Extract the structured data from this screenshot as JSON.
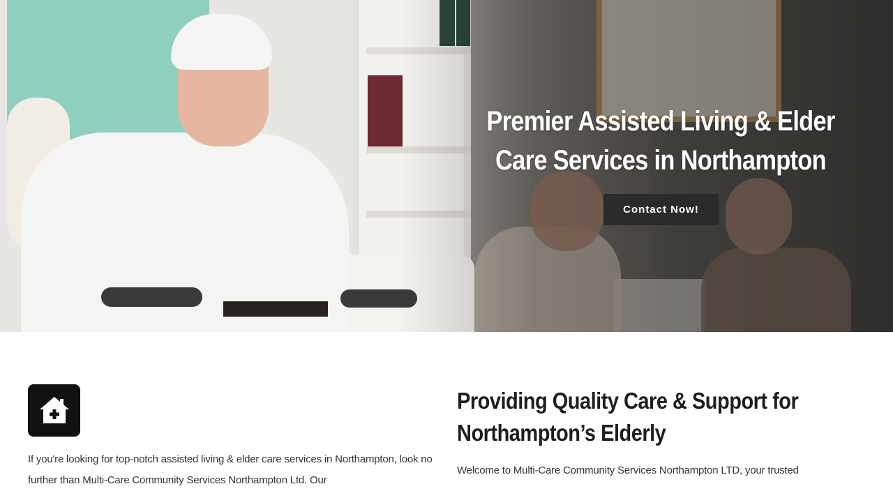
{
  "hero": {
    "title": "Premier Assisted Living & Elder Care Services in Northampton",
    "cta_label": "Contact Now!"
  },
  "intro": {
    "icon": "house-plus-icon",
    "text": "If you're looking for top-notch assisted living & elder care services in Northampton, look no further than Multi-Care Community Services Northampton Ltd. Our"
  },
  "section": {
    "title": "Providing Quality Care & Support for Northampton’s Elderly",
    "text": "Welcome to Multi-Care Community Services Northampton LTD, your trusted"
  },
  "colors": {
    "icon_box": "#111111",
    "cta_bg": "#2b2b2b",
    "heading": "#1e1e1e"
  }
}
